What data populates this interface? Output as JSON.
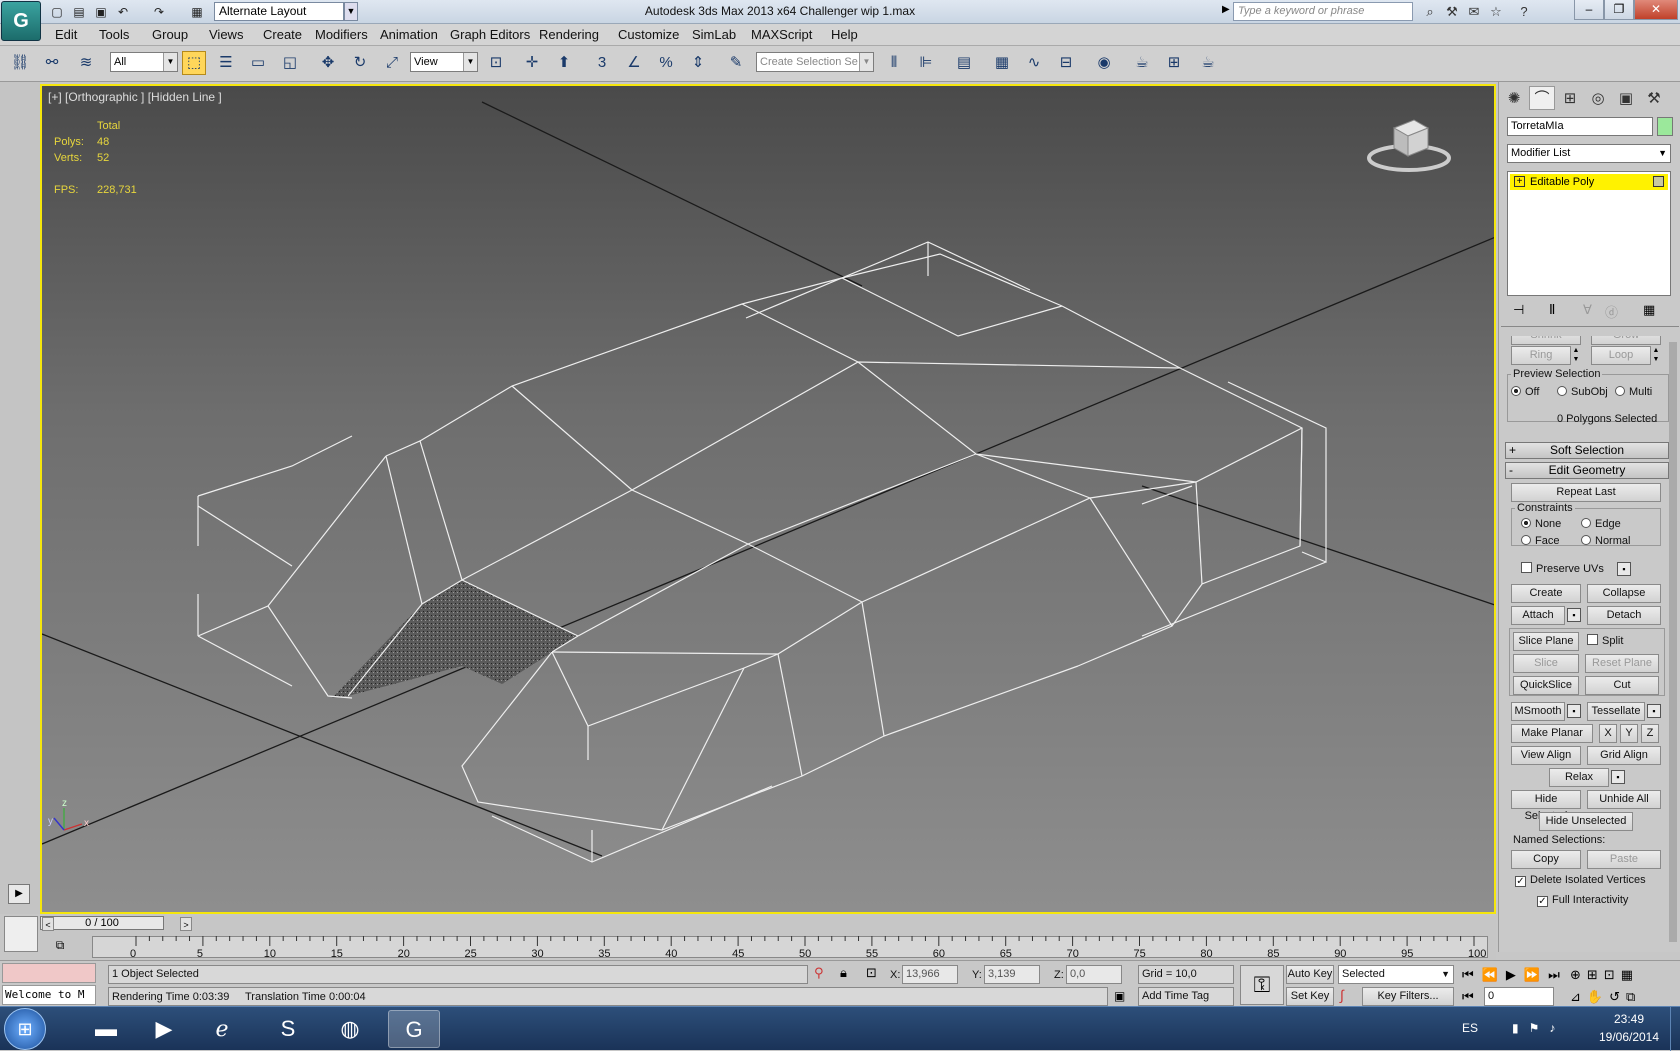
{
  "titlebar": {
    "layout": "Alternate Layout",
    "title": "Autodesk 3ds Max  2013 x64      Challenger wip 1.max",
    "search_placeholder": "Type a keyword or phrase"
  },
  "menu": [
    "Edit",
    "Tools",
    "Group",
    "Views",
    "Create",
    "Modifiers",
    "Animation",
    "Graph Editors",
    "Rendering",
    "Customize",
    "SimLab",
    "MAXScript",
    "Help"
  ],
  "toolbar": {
    "filter": "All",
    "ref_coord": "View",
    "selection_set_placeholder": "Create Selection Se"
  },
  "viewport": {
    "label": "[+] [Orthographic ] [Hidden Line ]",
    "stats": {
      "total_label": "Total",
      "polys_label": "Polys:",
      "polys": "48",
      "verts_label": "Verts:",
      "verts": "52",
      "fps_label": "FPS:",
      "fps": "228,731"
    }
  },
  "command_panel": {
    "object_name": "TorretaMIa",
    "object_color": "#9be89b",
    "modifier_list": "Modifier List",
    "stack_item": "Editable Poly",
    "shrink": "Shrink",
    "grow": "Grow",
    "ring": "Ring",
    "loop": "Loop",
    "preview_selection": "Preview Selection",
    "preview_off": "Off",
    "preview_subobj": "SubObj",
    "preview_multi": "Multi",
    "polygons_selected": "0 Polygons Selected",
    "soft_selection": "Soft Selection",
    "edit_geometry": "Edit Geometry",
    "repeat_last": "Repeat Last",
    "constraints": "Constraints",
    "c_none": "None",
    "c_edge": "Edge",
    "c_face": "Face",
    "c_normal": "Normal",
    "preserve_uvs": "Preserve UVs",
    "create": "Create",
    "collapse": "Collapse",
    "attach": "Attach",
    "detach": "Detach",
    "slice_plane": "Slice Plane",
    "split": "Split",
    "slice": "Slice",
    "reset_plane": "Reset Plane",
    "quickslice": "QuickSlice",
    "cut": "Cut",
    "msmooth": "MSmooth",
    "tessellate": "Tessellate",
    "make_planar": "Make Planar",
    "x": "X",
    "y": "Y",
    "z": "Z",
    "view_align": "View Align",
    "grid_align": "Grid Align",
    "relax": "Relax",
    "hide_selected": "Hide Selected",
    "unhide_all": "Unhide All",
    "hide_unselected": "Hide Unselected",
    "named_selections": "Named Selections:",
    "copy": "Copy",
    "paste": "Paste",
    "delete_isolated": "Delete Isolated Vertices",
    "full_interactivity": "Full Interactivity"
  },
  "timeline": {
    "slider": "0 / 100",
    "ticks": [
      "0",
      "5",
      "10",
      "15",
      "20",
      "25",
      "30",
      "35",
      "40",
      "45",
      "50",
      "55",
      "60",
      "65",
      "70",
      "75",
      "80",
      "85",
      "90",
      "95",
      "100"
    ]
  },
  "status": {
    "welcome": "Welcome to M",
    "selected": "1 Object Selected",
    "rendering_time": "Rendering Time  0:03:39",
    "translation_time": "Translation Time  0:00:04",
    "x_label": "X:",
    "x": "13,966",
    "y_label": "Y:",
    "y": "3,139",
    "z_label": "Z:",
    "z": "0,0",
    "grid": "Grid = 10,0",
    "add_time_tag": "Add Time Tag",
    "auto_key": "Auto Key",
    "set_key": "Set Key",
    "key_mode": "Selected",
    "key_filters": "Key Filters...",
    "frame": "0"
  },
  "taskbar": {
    "lang": "ES",
    "time": "23:49",
    "date": "19/06/2014"
  }
}
